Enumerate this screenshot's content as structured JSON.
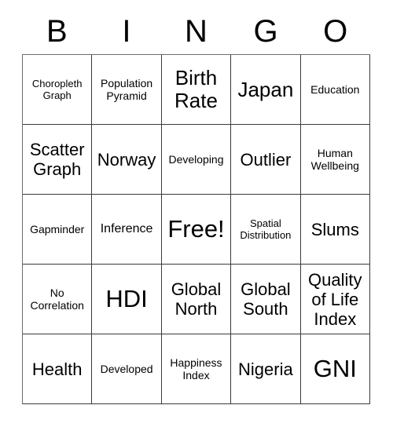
{
  "card": {
    "title": "BINGO",
    "header_letters": [
      "B",
      "I",
      "N",
      "G",
      "O"
    ],
    "free_space": "Free!",
    "colors": {
      "background": "#ffffff",
      "text": "#000000",
      "grid_line": "#3a3a3a",
      "outer_line": "#6d6d6d"
    },
    "grid": {
      "columns": 5,
      "rows": 5,
      "cells": [
        {
          "text": "Choropleth Graph",
          "size": "xs"
        },
        {
          "text": "Population Pyramid",
          "size": "s"
        },
        {
          "text": "Birth Rate",
          "size": "xl"
        },
        {
          "text": "Japan",
          "size": "xl"
        },
        {
          "text": "Education",
          "size": "s"
        },
        {
          "text": "Scatter Graph",
          "size": "l"
        },
        {
          "text": "Norway",
          "size": "l"
        },
        {
          "text": "Developing",
          "size": "s"
        },
        {
          "text": "Outlier",
          "size": "l"
        },
        {
          "text": "Human Wellbeing",
          "size": "s"
        },
        {
          "text": "Gapminder",
          "size": "s"
        },
        {
          "text": "Inference",
          "size": "m"
        },
        {
          "text": "Free!",
          "size": "huge"
        },
        {
          "text": "Spatial Distribution",
          "size": "xs"
        },
        {
          "text": "Slums",
          "size": "l"
        },
        {
          "text": "No Correlation",
          "size": "s"
        },
        {
          "text": "HDI",
          "size": "huge"
        },
        {
          "text": "Global North",
          "size": "l"
        },
        {
          "text": "Global South",
          "size": "l"
        },
        {
          "text": "Quality of Life Index",
          "size": "l"
        },
        {
          "text": "Health",
          "size": "l"
        },
        {
          "text": "Developed",
          "size": "s"
        },
        {
          "text": "Happiness Index",
          "size": "s"
        },
        {
          "text": "Nigeria",
          "size": "l"
        },
        {
          "text": "GNI",
          "size": "huge"
        }
      ]
    }
  }
}
